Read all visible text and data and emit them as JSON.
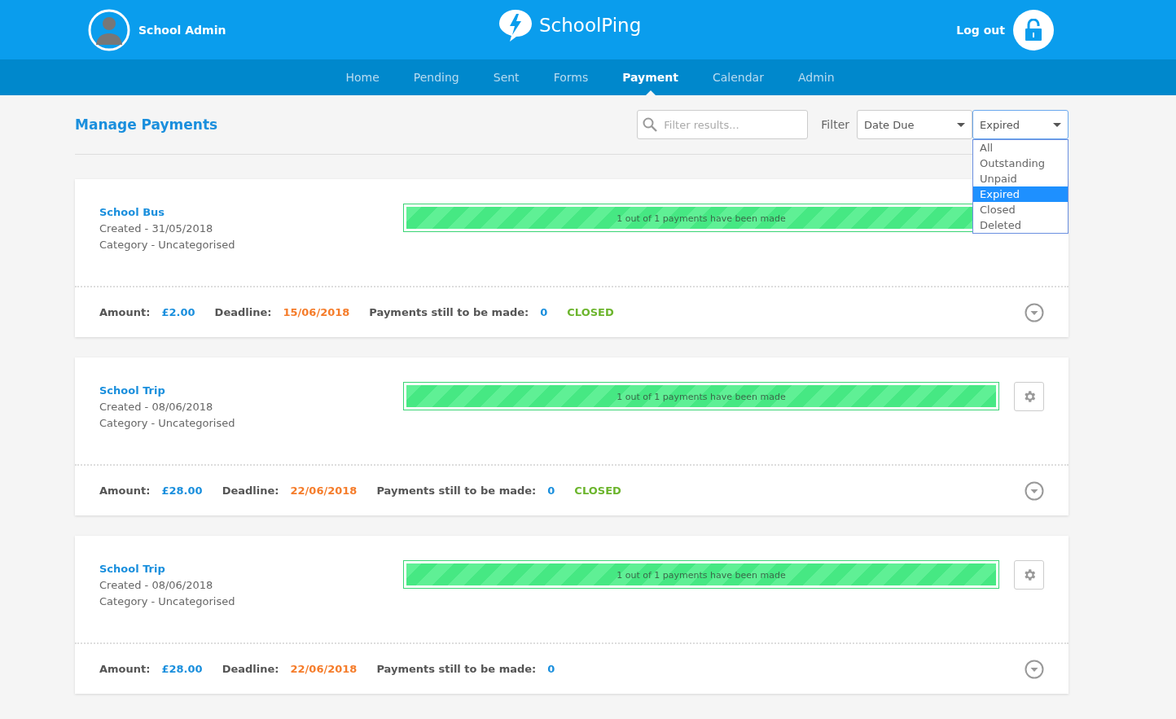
{
  "header": {
    "user": "School Admin",
    "brand": "SchoolPing",
    "logout": "Log out"
  },
  "nav": [
    {
      "label": "Home",
      "selected": false
    },
    {
      "label": "Pending",
      "selected": false
    },
    {
      "label": "Sent",
      "selected": false
    },
    {
      "label": "Forms",
      "selected": false
    },
    {
      "label": "Payment",
      "selected": true
    },
    {
      "label": "Calendar",
      "selected": false
    },
    {
      "label": "Admin",
      "selected": false
    }
  ],
  "page_title": "Manage Payments",
  "search": {
    "placeholder": "Filter results..."
  },
  "filter_label": "Filter",
  "sort_select": {
    "value": "Date Due"
  },
  "status_select": {
    "value": "Expired",
    "expanded": true,
    "options": [
      {
        "label": "All",
        "selected": false
      },
      {
        "label": "Outstanding",
        "selected": false
      },
      {
        "label": "Unpaid",
        "selected": false
      },
      {
        "label": "Expired",
        "selected": true
      },
      {
        "label": "Closed",
        "selected": false
      },
      {
        "label": "Deleted",
        "selected": false
      }
    ]
  },
  "payments": [
    {
      "title": "School Bus",
      "created": "Created - 31/05/2018",
      "category": "Category - Uncategorised",
      "progress_text": "1 out of 1 payments have been made",
      "level": 1,
      "amount_label": "Amount:",
      "amount": "£2.00",
      "deadline_label": "Deadline:",
      "deadline": "15/06/2018",
      "remaining_label": "Payments still to be made:",
      "remaining": "0",
      "status": "CLOSED"
    },
    {
      "title": "School Trip",
      "created": "Created - 08/06/2018",
      "category": "Category - Uncategorised",
      "progress_text": "1 out of 1 payments have been made",
      "level": 1,
      "amount_label": "Amount:",
      "amount": "£28.00",
      "deadline_label": "Deadline:",
      "deadline": "22/06/2018",
      "remaining_label": "Payments still to be made:",
      "remaining": "0",
      "status": "CLOSED"
    },
    {
      "title": "School Trip",
      "created": "Created - 08/06/2018",
      "category": "Category - Uncategorised",
      "progress_text": "1 out of 1 payments have been made",
      "level": 1,
      "amount_label": "Amount:",
      "amount": "£28.00",
      "deadline_label": "Deadline:",
      "deadline": "22/06/2018",
      "remaining_label": "Payments still to be made:",
      "remaining": "0"
    }
  ]
}
